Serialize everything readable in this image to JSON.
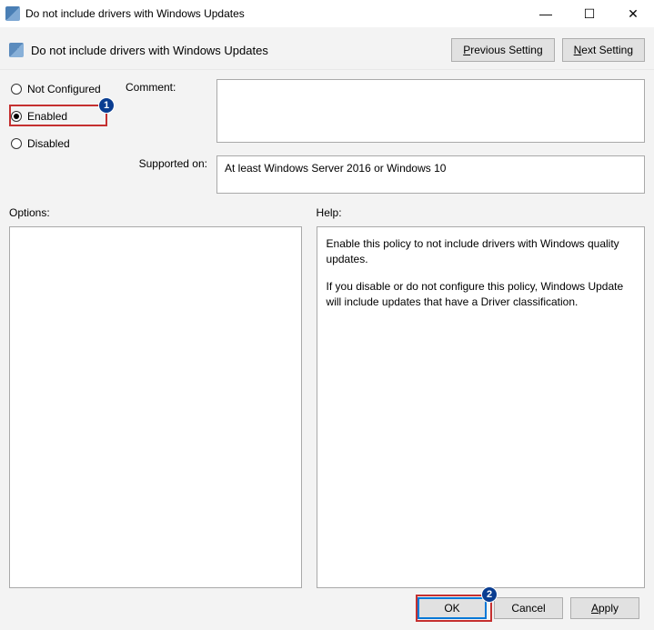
{
  "titlebar": {
    "title": "Do not include drivers with Windows Updates"
  },
  "subheader": {
    "title": "Do not include drivers with Windows Updates",
    "previous_label_prefix": "P",
    "previous_label_rest": "revious Setting",
    "next_label_prefix": "N",
    "next_label_rest": "ext Setting"
  },
  "radios": {
    "not_configured": "Not Configured",
    "enabled": "Enabled",
    "disabled": "Disabled"
  },
  "badges": {
    "one": "1",
    "two": "2"
  },
  "fields": {
    "comment_label": "Comment:",
    "comment_value": "",
    "supported_label": "Supported on:",
    "supported_value": "At least Windows Server 2016 or Windows 10"
  },
  "panels": {
    "options_label": "Options:",
    "help_label": "Help:",
    "help_para1": "Enable this policy to not include drivers with Windows quality updates.",
    "help_para2": "If you disable or do not configure this policy, Windows Update will include updates that have a Driver classification."
  },
  "buttons": {
    "ok": "OK",
    "cancel": "Cancel",
    "apply_prefix": "A",
    "apply_rest": "pply"
  }
}
